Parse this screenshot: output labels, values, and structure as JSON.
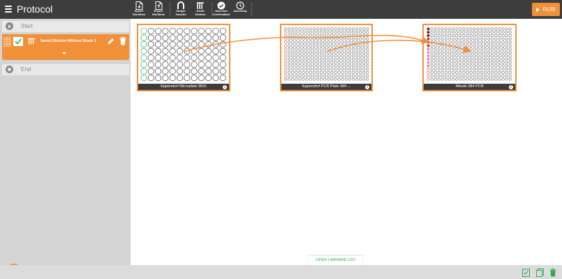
{
  "app": {
    "title": "Protocol"
  },
  "toolbar": {
    "buttons": [
      {
        "label": "Import\nWorkflow",
        "icon": "import-file-icon"
      },
      {
        "label": "Export\nWorkflow",
        "icon": "export-file-icon"
      },
      {
        "label": "Simple\nTransfer",
        "icon": "simple-transfer-icon"
      },
      {
        "label": "Serial\nDilution",
        "icon": "serial-dilution-icon"
      },
      {
        "label": "Add User\nConfirmation",
        "icon": "user-confirmation-icon"
      },
      {
        "label": "Add Delay",
        "icon": "clock-icon"
      }
    ],
    "run_label": "RUN"
  },
  "sidebar": {
    "start_label": "Start",
    "end_label": "End",
    "steps": [
      {
        "name": "Serial Dilution Without Stock 1",
        "checked": true
      }
    ]
  },
  "labware": [
    {
      "name": "Eppendorf Microplate 96/U",
      "rows": 8,
      "cols": 12
    },
    {
      "name": "Eppendorf PCR Plate 384 ...",
      "rows": 16,
      "cols": 24
    },
    {
      "name": "4titude 384 PCR",
      "rows": 16,
      "cols": 24
    }
  ],
  "footer": {
    "open_labware_label": "OPEN LABWARE LIST"
  },
  "colors": {
    "topbar": "#3d3d3d",
    "accent": "#f0913a",
    "sidebar": "#d4d4d4",
    "well_green": "#2eaa55",
    "well_red": "#c0392b",
    "well_pink": "#e48ab5",
    "well_dark": "#7a1a1a",
    "link_green": "#2eaa55"
  }
}
